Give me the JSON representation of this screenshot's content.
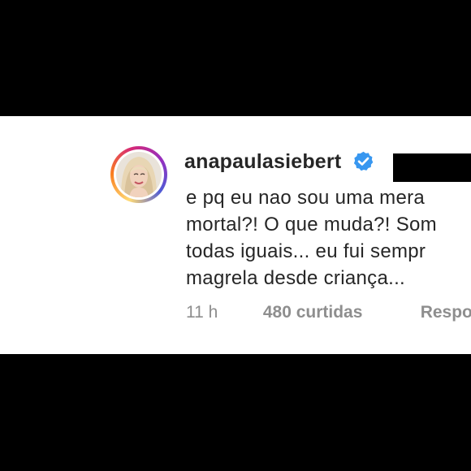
{
  "comment": {
    "username": "anapaulasiebert",
    "verified": true,
    "text": "e pq eu nao sou uma mera\nmortal?! O que muda?! Som\ntodas iguais... eu fui sempr\nmagrela desde criança...",
    "time": "11 h",
    "likes": "480 curtidas",
    "reply_label": "Respor"
  },
  "colors": {
    "text": "#262626",
    "meta": "#8e8e8e",
    "verified_badge": "#3897f0",
    "background_frame": "#000000",
    "card": "#ffffff"
  },
  "icons": {
    "verified": "verified-badge-icon",
    "avatar": "profile-avatar"
  }
}
